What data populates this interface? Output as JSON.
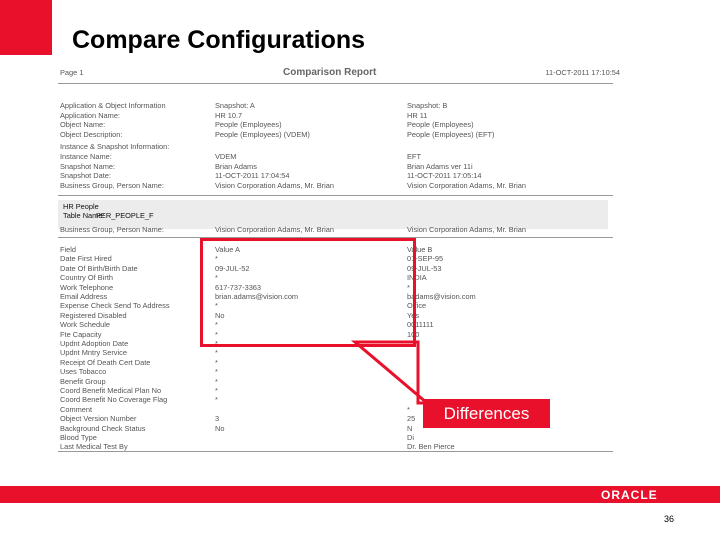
{
  "slide": {
    "title": "Compare Configurations",
    "page_number": "36",
    "logo": "ORACLE"
  },
  "report": {
    "page_label": "Page 1",
    "title": "Comparison Report",
    "date": "11-OCT-2011 17:10:54",
    "section1": {
      "rows": [
        {
          "label": "Application & Object Information",
          "a": "Snapshot: A",
          "b": "Snapshot: B"
        },
        {
          "label": "Application Name:",
          "a": "HR 10.7",
          "b": "HR 11"
        },
        {
          "label": "Object Name:",
          "a": "People (Employees)",
          "b": "People (Employees)"
        },
        {
          "label": "Object Description:",
          "a": "People (Employees) (VDEM)",
          "b": "People (Employees) (EFT)"
        },
        {
          "label": "Instance & Snapshot Information:",
          "a": "",
          "b": ""
        },
        {
          "label": "Instance Name:",
          "a": "VDEM",
          "b": "EFT"
        },
        {
          "label": "Snapshot Name:",
          "a": "Brian Adams",
          "b": "Brian Adams ver 11i"
        },
        {
          "label": "Snapshot Date:",
          "a": "11-OCT-2011 17:04:54",
          "b": "11-OCT-2011 17:05:14"
        },
        {
          "label": "Business Group, Person Name:",
          "a": "Vision Corporation Adams, Mr. Brian",
          "b": "Vision Corporation Adams, Mr. Brian"
        }
      ]
    },
    "section2": {
      "line1": "HR People",
      "line2_label": "Table Name:",
      "line2_value": "PER_PEOPLE_F",
      "bg_label": "Business Group, Person Name:",
      "bg_a": "Vision Corporation Adams, Mr. Brian",
      "bg_b": "Vision Corporation Adams, Mr. Brian"
    },
    "fields": [
      {
        "label": "Field",
        "a": "Value A",
        "b": "Value B"
      },
      {
        "label": "Date First Hired",
        "a": "*",
        "b": "01-SEP-95"
      },
      {
        "label": "Date Of Birth/Birth Date",
        "a": "09-JUL-52",
        "b": "09-JUL-53"
      },
      {
        "label": "Country Of Birth",
        "a": "*",
        "b": "INDIA"
      },
      {
        "label": "Work Telephone",
        "a": "617-737-3363",
        "b": "*"
      },
      {
        "label": "Email Address",
        "a": "brian.adams@vision.com",
        "b": "badams@vision.com"
      },
      {
        "label": "Expense Check Send To Address",
        "a": "*",
        "b": "Office"
      },
      {
        "label": "Registered Disabled",
        "a": "No",
        "b": "Yes"
      },
      {
        "label": "Work Schedule",
        "a": "*",
        "b": "0011111"
      },
      {
        "label": "Fte Capacity",
        "a": "*",
        "b": "100"
      },
      {
        "label": "Updnt Adoption Date",
        "a": "*",
        "b": ""
      },
      {
        "label": "Updnt Mntry Service",
        "a": "*",
        "b": ""
      },
      {
        "label": "Receipt Of Death Cert Date",
        "a": "*",
        "b": ""
      },
      {
        "label": "Uses Tobacco",
        "a": "*",
        "b": ""
      },
      {
        "label": "Benefit Group",
        "a": "*",
        "b": ""
      },
      {
        "label": "Coord Benefit Medical Plan No",
        "a": "*",
        "b": ""
      },
      {
        "label": "Coord Benefit No Coverage Flag",
        "a": "*",
        "b": ""
      },
      {
        "label": "Comment",
        "a": "",
        "b": "*"
      },
      {
        "label": "Object Version Number",
        "a": "3",
        "b": "25"
      },
      {
        "label": "Background Check Status",
        "a": "No",
        "b": "N"
      },
      {
        "label": "Blood Type",
        "a": "",
        "b": "Di"
      },
      {
        "label": "Last Medical Test By",
        "a": "",
        "b": "Dr. Ben Pierce"
      }
    ]
  },
  "callout": {
    "label": "Differences"
  }
}
